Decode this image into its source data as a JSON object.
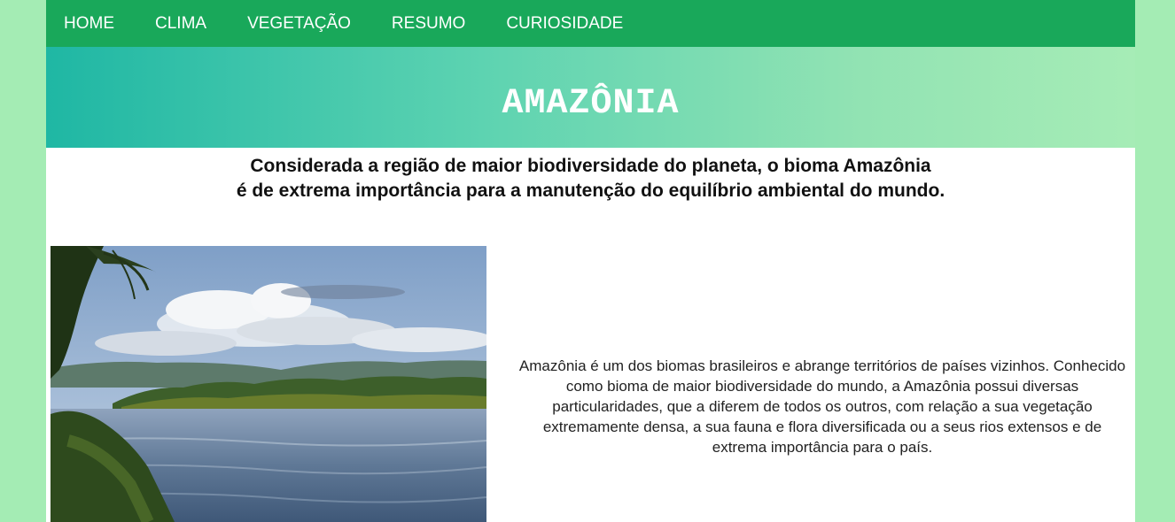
{
  "nav": {
    "items": [
      {
        "label": "HOME"
      },
      {
        "label": "CLIMA"
      },
      {
        "label": "VEGETAÇÃO"
      },
      {
        "label": "RESUMO"
      },
      {
        "label": "CURIOSIDADE"
      }
    ]
  },
  "hero": {
    "title": "AMAZÔNIA"
  },
  "intro": {
    "line1": "Considerada a região de maior biodiversidade do planeta, o bioma Amazônia",
    "line2": "é de extrema importância para a manutenção do equilíbrio ambiental do mundo."
  },
  "description": {
    "text": "Amazônia é um dos biomas brasileiros e abrange territórios de países vizinhos. Conhecido como bioma de maior biodiversidade do mundo, a Amazônia possui diversas particularidades, que a diferem de todos os outros, com relação a sua vegetação extremamente densa, a sua fauna e flora diversificada ou a seus rios extensos e de extrema importância para o país."
  },
  "colors": {
    "page_background": "#a4ecb4",
    "nav_background": "#19a85a",
    "hero_gradient_start": "#1fb7a4",
    "hero_gradient_end": "#a6ecb6"
  }
}
